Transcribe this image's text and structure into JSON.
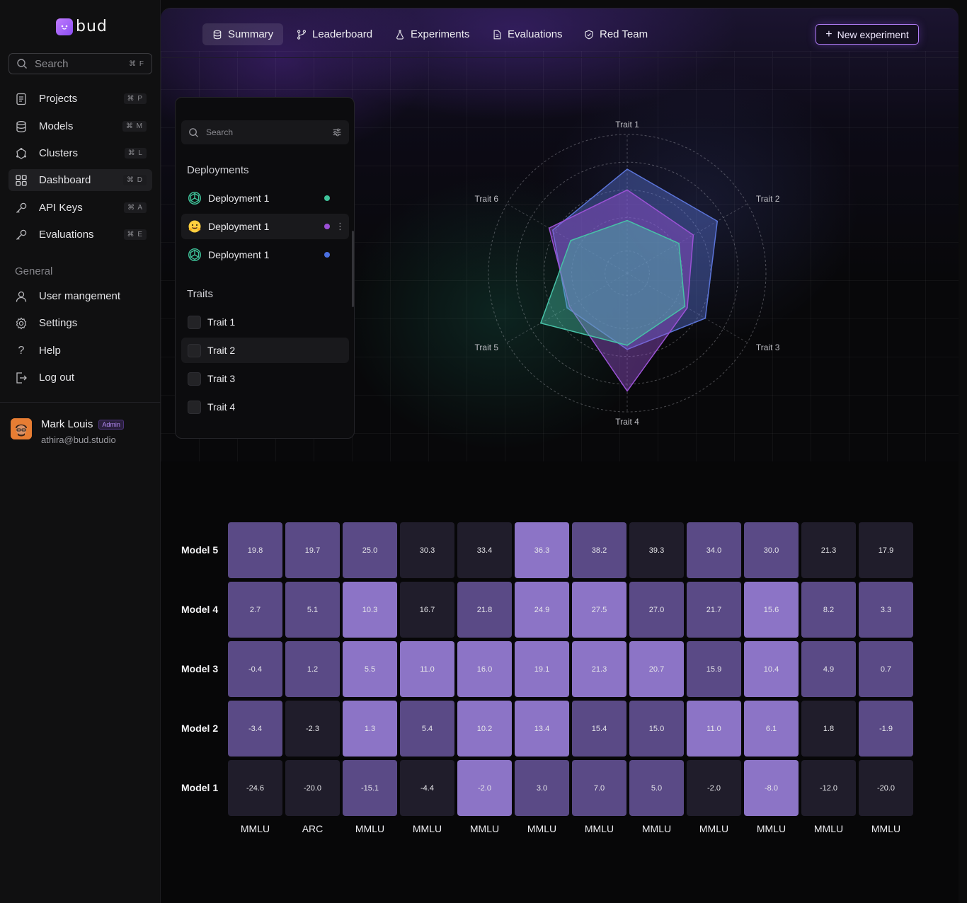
{
  "app": {
    "brand": "bud"
  },
  "sidebar": {
    "search": {
      "placeholder": "Search",
      "shortcut": "⌘ F"
    },
    "items": [
      {
        "label": "Projects",
        "shortcut": "⌘ P",
        "icon": "document-icon"
      },
      {
        "label": "Models",
        "shortcut": "⌘ M",
        "icon": "database-icon"
      },
      {
        "label": "Clusters",
        "shortcut": "⌘ L",
        "icon": "cluster-icon"
      },
      {
        "label": "Dashboard",
        "shortcut": "⌘ D",
        "icon": "grid-icon",
        "active": true
      },
      {
        "label": "API Keys",
        "shortcut": "⌘ A",
        "icon": "key-icon"
      },
      {
        "label": "Evaluations",
        "shortcut": "⌘ E",
        "icon": "key-icon"
      }
    ],
    "general_title": "General",
    "general_items": [
      {
        "label": "User mangement",
        "icon": "user-icon"
      },
      {
        "label": "Settings",
        "icon": "gear-icon"
      },
      {
        "label": "Help",
        "icon": "help-icon"
      },
      {
        "label": "Log out",
        "icon": "logout-icon"
      }
    ],
    "user": {
      "name": "Mark Louis",
      "role": "Admin",
      "email": "athira@bud.studio"
    }
  },
  "header": {
    "tabs": [
      {
        "label": "Summary",
        "icon": "database-icon",
        "active": true
      },
      {
        "label": "Leaderboard",
        "icon": "branch-icon"
      },
      {
        "label": "Experiments",
        "icon": "flask-icon"
      },
      {
        "label": "Evaluations",
        "icon": "file-icon"
      },
      {
        "label": "Red Team",
        "icon": "shield-icon"
      }
    ],
    "new_button": "New experiment"
  },
  "filter_panel": {
    "search_placeholder": "Search",
    "deployments_title": "Deployments",
    "deployments": [
      {
        "label": "Deployment 1",
        "icon": "openai-icon",
        "color": "#3fc39a"
      },
      {
        "label": "Deployment 1",
        "icon": "hugging-face-icon",
        "color": "#9b4fd6"
      },
      {
        "label": "Deployment 1",
        "icon": "openai-icon",
        "color": "#4a6fe0"
      }
    ],
    "traits_title": "Traits",
    "traits": [
      "Trait 1",
      "Trait 2",
      "Trait 3",
      "Trait 4"
    ]
  },
  "chart_data": [
    {
      "type": "radar",
      "axes": [
        "Trait 1",
        "Trait 2",
        "Trait 3",
        "Trait 4",
        "Trait 5",
        "Trait 6"
      ],
      "range": [
        0,
        100
      ],
      "series": [
        {
          "values": [
            75,
            75,
            65,
            55,
            50,
            62
          ],
          "color": "#5b74d8"
        },
        {
          "values": [
            60,
            55,
            50,
            85,
            48,
            65
          ],
          "color": "#9a52d4"
        },
        {
          "values": [
            38,
            43,
            48,
            52,
            72,
            47
          ],
          "color": "#47c2a7"
        }
      ]
    },
    {
      "type": "heatmap",
      "rows": [
        "Model 5",
        "Model 4",
        "Model 3",
        "Model 2",
        "Model 1"
      ],
      "columns": [
        "MMLU",
        "ARC",
        "MMLU",
        "MMLU",
        "MMLU",
        "MMLU",
        "MMLU",
        "MMLU",
        "MMLU",
        "MMLU",
        "MMLU",
        "MMLU"
      ],
      "values": [
        [
          19.8,
          19.7,
          25.0,
          30.3,
          33.4,
          36.3,
          38.2,
          39.3,
          34.0,
          30.0,
          21.3,
          17.9
        ],
        [
          2.7,
          5.1,
          10.3,
          16.7,
          21.8,
          24.9,
          27.5,
          27.0,
          21.7,
          15.6,
          8.2,
          3.3
        ],
        [
          -0.4,
          1.2,
          5.5,
          11.0,
          16.0,
          19.1,
          21.3,
          20.7,
          15.9,
          10.4,
          4.9,
          0.7
        ],
        [
          -3.4,
          -2.3,
          1.3,
          5.4,
          10.2,
          13.4,
          15.4,
          15.0,
          11.0,
          6.1,
          1.8,
          -1.9
        ],
        [
          -24.6,
          -20.0,
          -15.1,
          -4.4,
          -2.0,
          3.0,
          7.0,
          5.0,
          -2.0,
          -8.0,
          -12.0,
          -20.0
        ]
      ],
      "shades": [
        [
          1,
          1,
          1,
          0,
          0,
          2,
          1,
          0,
          1,
          1,
          0,
          0
        ],
        [
          1,
          1,
          2,
          0,
          1,
          2,
          2,
          1,
          1,
          2,
          1,
          1
        ],
        [
          1,
          1,
          2,
          2,
          2,
          2,
          2,
          2,
          1,
          2,
          1,
          1
        ],
        [
          1,
          0,
          2,
          1,
          2,
          2,
          1,
          1,
          2,
          2,
          0,
          1
        ],
        [
          0,
          0,
          1,
          0,
          2,
          1,
          1,
          1,
          0,
          2,
          0,
          0
        ]
      ],
      "shade_colors": [
        "#201d2b",
        "#5a4a86",
        "#8c74c6"
      ]
    }
  ]
}
